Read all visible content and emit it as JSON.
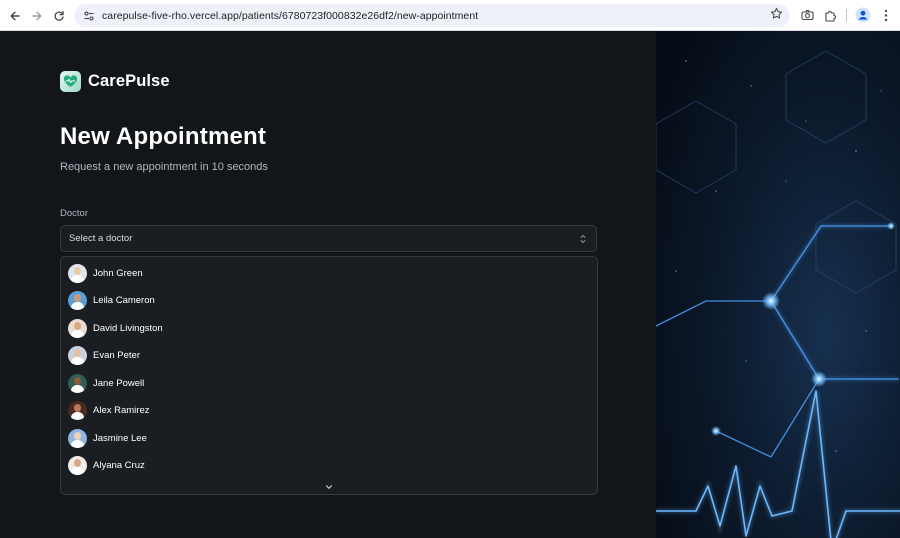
{
  "browser": {
    "url": "carepulse-five-rho.vercel.app/patients/6780723f000832e26df2/new-appointment"
  },
  "app": {
    "logo_text": "CarePulse"
  },
  "header": {
    "title": "New Appointment",
    "subtitle": "Request a new appointment in 10 seconds"
  },
  "form": {
    "doctor_label": "Doctor",
    "doctor_placeholder": "Select a doctor"
  },
  "doctors": [
    {
      "name": "John Green",
      "skin": "#e9c9a8",
      "bg": "#dfe6ea"
    },
    {
      "name": "Leila Cameron",
      "skin": "#c89b7b",
      "bg": "#5aa0d6"
    },
    {
      "name": "David Livingston",
      "skin": "#d8a982",
      "bg": "#e7ddd4"
    },
    {
      "name": "Evan Peter",
      "skin": "#e6c2a0",
      "bg": "#c8d3de"
    },
    {
      "name": "Jane Powell",
      "skin": "#8a5a3c",
      "bg": "#2f5d53"
    },
    {
      "name": "Alex Ramirez",
      "skin": "#b77a55",
      "bg": "#4a2a22"
    },
    {
      "name": "Jasmine Lee",
      "skin": "#efcfb6",
      "bg": "#8fb6e2"
    },
    {
      "name": "Alyana Cruz",
      "skin": "#d9a887",
      "bg": "#f1ece6"
    }
  ],
  "colors": {
    "page_bg": "#131619",
    "panel_bg": "#1a1d21",
    "border": "#363a3d",
    "muted_text": "#abb8c4",
    "accent_glow": "#4fa3ff"
  }
}
